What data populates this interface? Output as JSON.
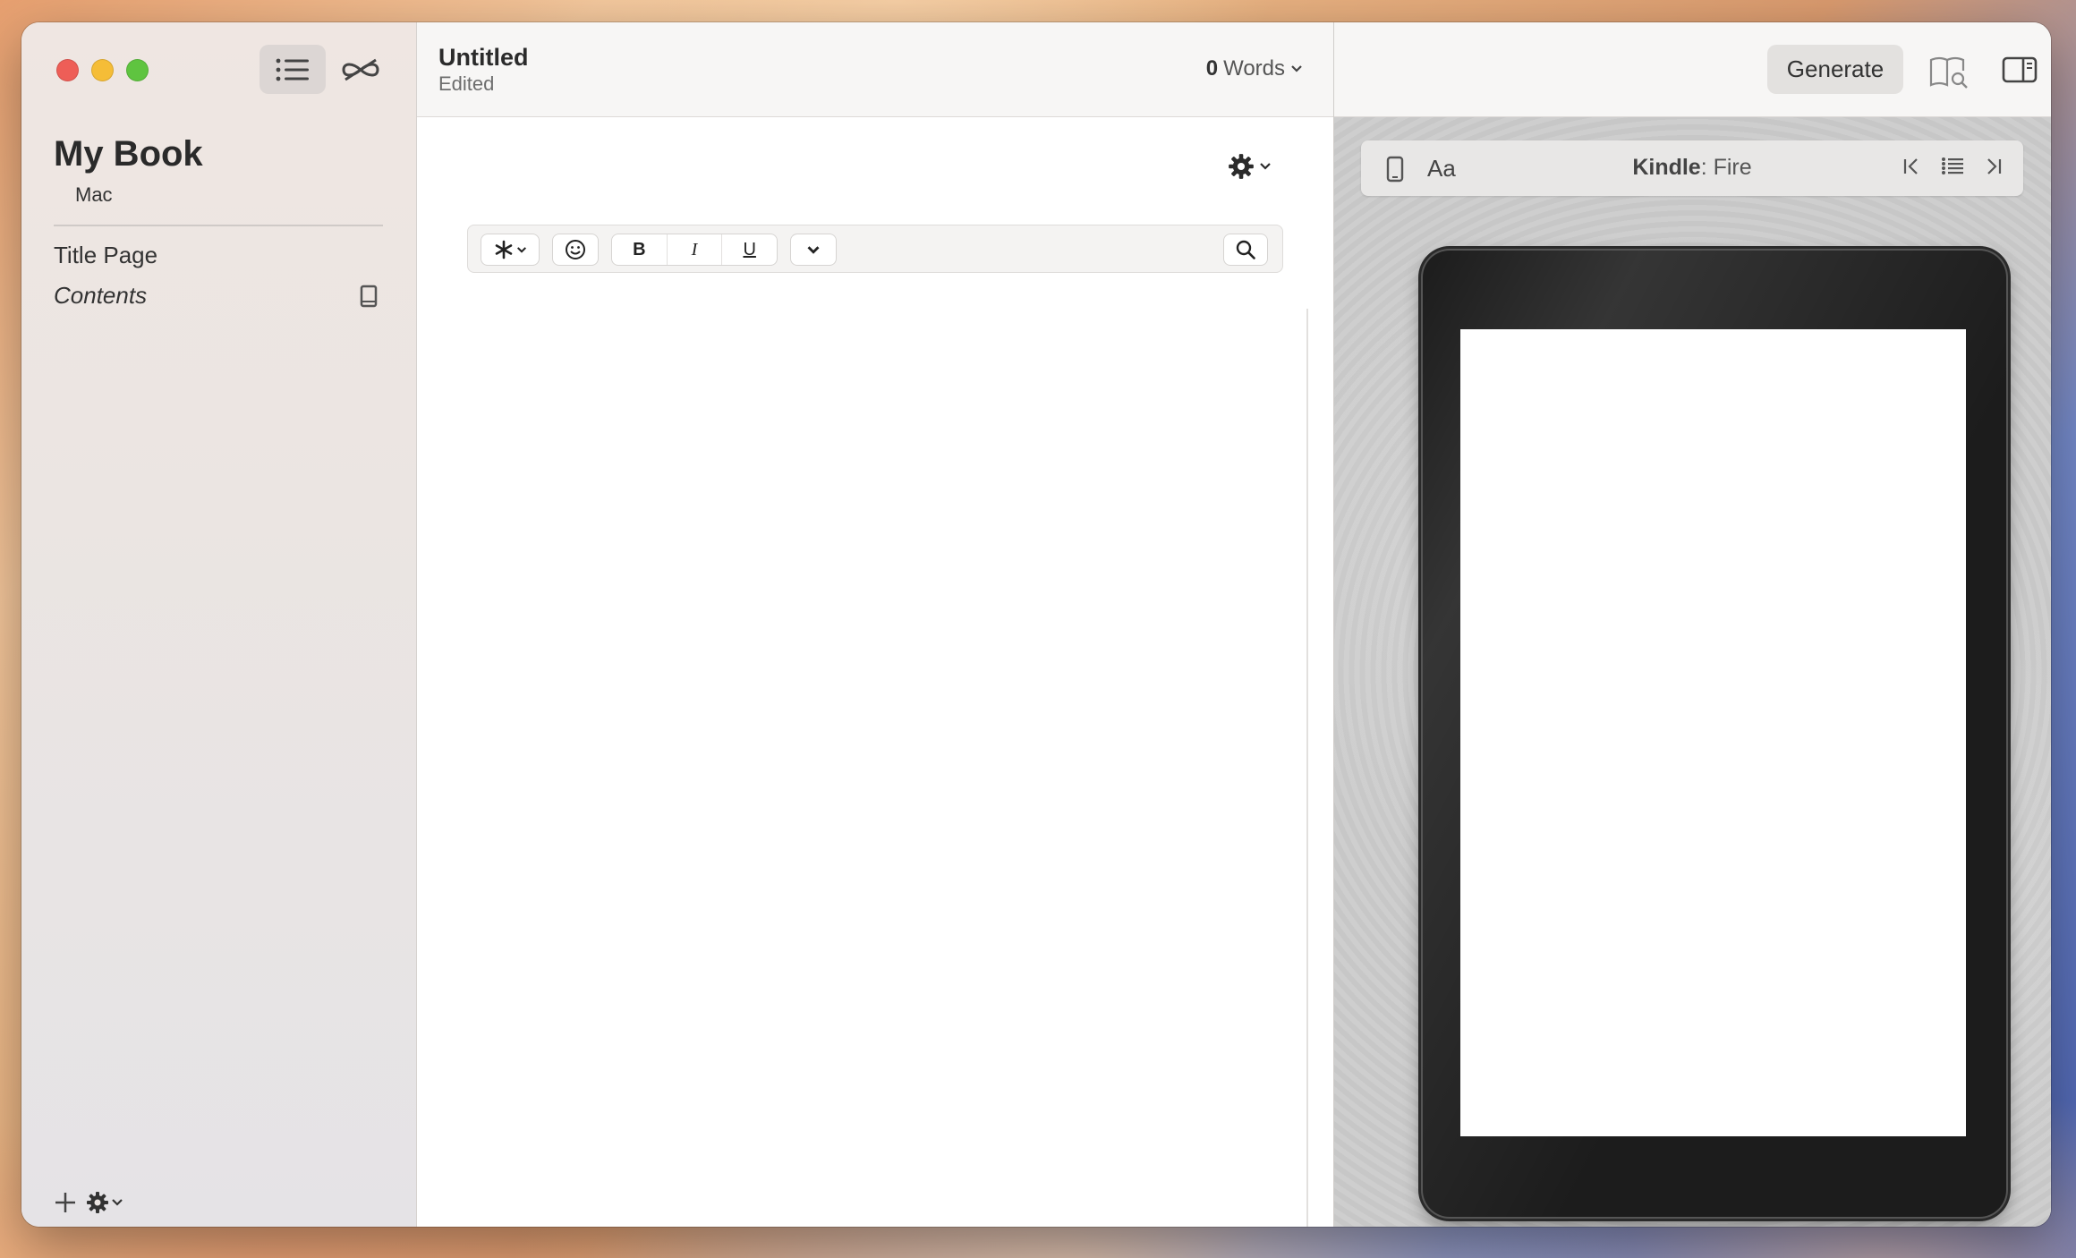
{
  "sidebar": {
    "book_title": "My Book",
    "book_subtitle": "Mac",
    "items": [
      {
        "label": "Title Page"
      },
      {
        "label": "Contents"
      }
    ]
  },
  "editor": {
    "doc_title": "Untitled",
    "doc_status": "Edited",
    "word_count": "0",
    "word_label": "Words",
    "format": {
      "bold": "B",
      "italic": "I",
      "underline": "U"
    }
  },
  "preview": {
    "generate_label": "Generate",
    "font_label": "Aa",
    "device_brand": "Kindle",
    "device_model": ": Fire"
  },
  "colors": {
    "close": "#ee5e57",
    "minimize": "#f5bd37",
    "zoom": "#5fc440"
  }
}
